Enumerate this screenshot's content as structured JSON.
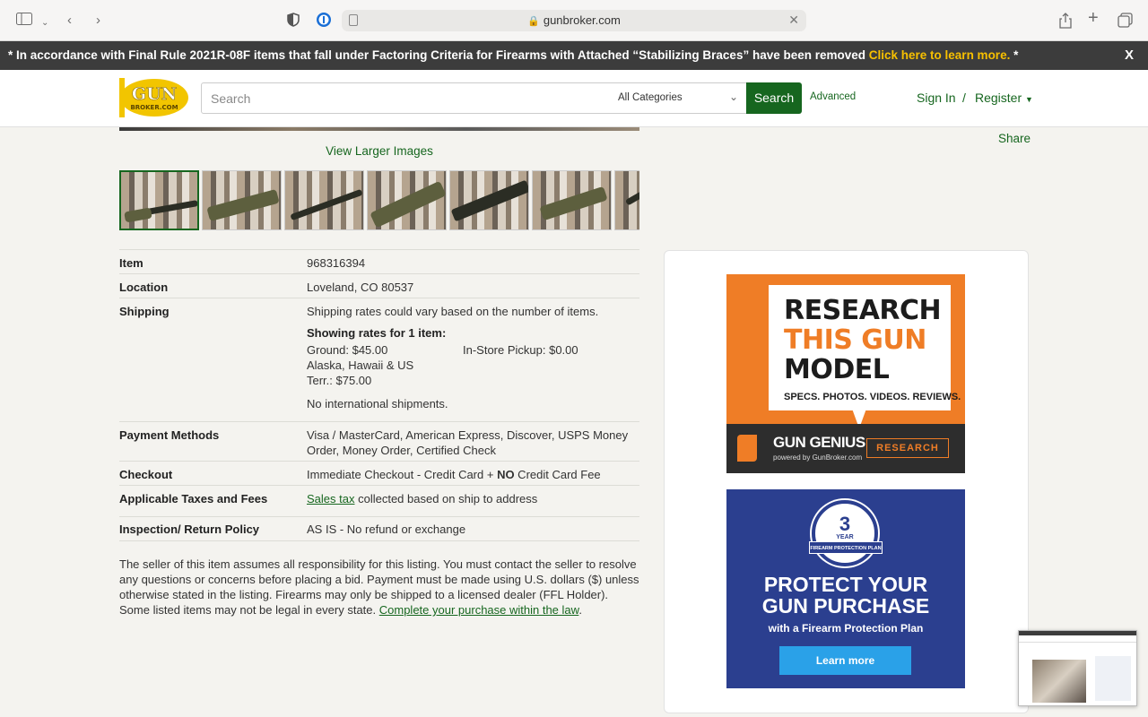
{
  "browser": {
    "url": "gunbroker.com"
  },
  "banner": {
    "text": "* In accordance with Final Rule 2021R-08F items that fall under Factoring Criteria for Firearms with Attached “Stabilizing Braces” have been removed ",
    "link": "Click here to learn more.",
    "suffix": " *",
    "close": "X"
  },
  "header": {
    "logo_line1": "GUN",
    "logo_line2": "BROKER.COM",
    "search_placeholder": "Search",
    "category": "All Categories",
    "search_button": "Search",
    "advanced": "Advanced",
    "sign_in": "Sign In",
    "separator": "/",
    "register": "Register"
  },
  "gallery": {
    "view_larger": "View Larger Images",
    "share": "Share"
  },
  "details": {
    "item_label": "Item",
    "item_value": "968316394",
    "location_label": "Location",
    "location_value": "Loveland, CO 80537",
    "shipping_label": "Shipping",
    "shipping_note": "Shipping rates could vary based on the number of items.",
    "showing_rates": "Showing rates for 1 item:",
    "ground": "Ground:  $45.00",
    "alaska": "Alaska, Hawaii & US Terr.:  $75.00",
    "pickup": "In-Store Pickup:  $0.00",
    "no_international": "No international shipments.",
    "payment_label": "Payment Methods",
    "payment_value": "Visa / MasterCard, American Express, Discover, USPS Money Order, Money Order, Certified Check",
    "checkout_label": "Checkout",
    "checkout_prefix": "Immediate Checkout - Credit Card + ",
    "checkout_bold": "NO",
    "checkout_suffix": " Credit Card Fee",
    "taxes_label": "Applicable Taxes and Fees",
    "taxes_link": "Sales tax",
    "taxes_suffix": " collected based on ship to address",
    "inspection_label": "Inspection/ Return Policy",
    "inspection_value": "AS IS - No refund or exchange"
  },
  "disclaimer": {
    "text": "The seller of this item assumes all responsibility for this listing. You must contact the seller to resolve any questions or concerns before placing a bid. Payment must be made using U.S. dollars ($) unless otherwise stated in the listing. Firearms may only be shipped to a licensed dealer (FFL Holder). Some listed items may not be legal in every state. ",
    "link": "Complete your purchase within the law",
    "end": "."
  },
  "ads": {
    "ad1_line1": "RESEARCH",
    "ad1_line2": "THIS GUN",
    "ad1_line3": "MODEL",
    "ad1_sub": "SPECS. PHOTOS. VIDEOS. REVIEWS.",
    "ad1_brand": "GUN GENIUS",
    "ad1_powered": "powered by GunBroker.com",
    "ad1_button": "RESEARCH",
    "ad2_badge_num": "3",
    "ad2_badge_year": "YEAR",
    "ad2_ribbon": "FIREARM PROTECTION PLAN",
    "ad2_line1": "PROTECT YOUR",
    "ad2_line2": "GUN PURCHASE",
    "ad2_sub": "with a Firearm Protection Plan",
    "ad2_button": "Learn more"
  },
  "colors": {
    "brand_green": "#16661f",
    "banner_bg": "#3c3c3c",
    "banner_link": "#f7c000",
    "ad_orange": "#ef7d26",
    "ad_blue": "#2b3f8f"
  }
}
